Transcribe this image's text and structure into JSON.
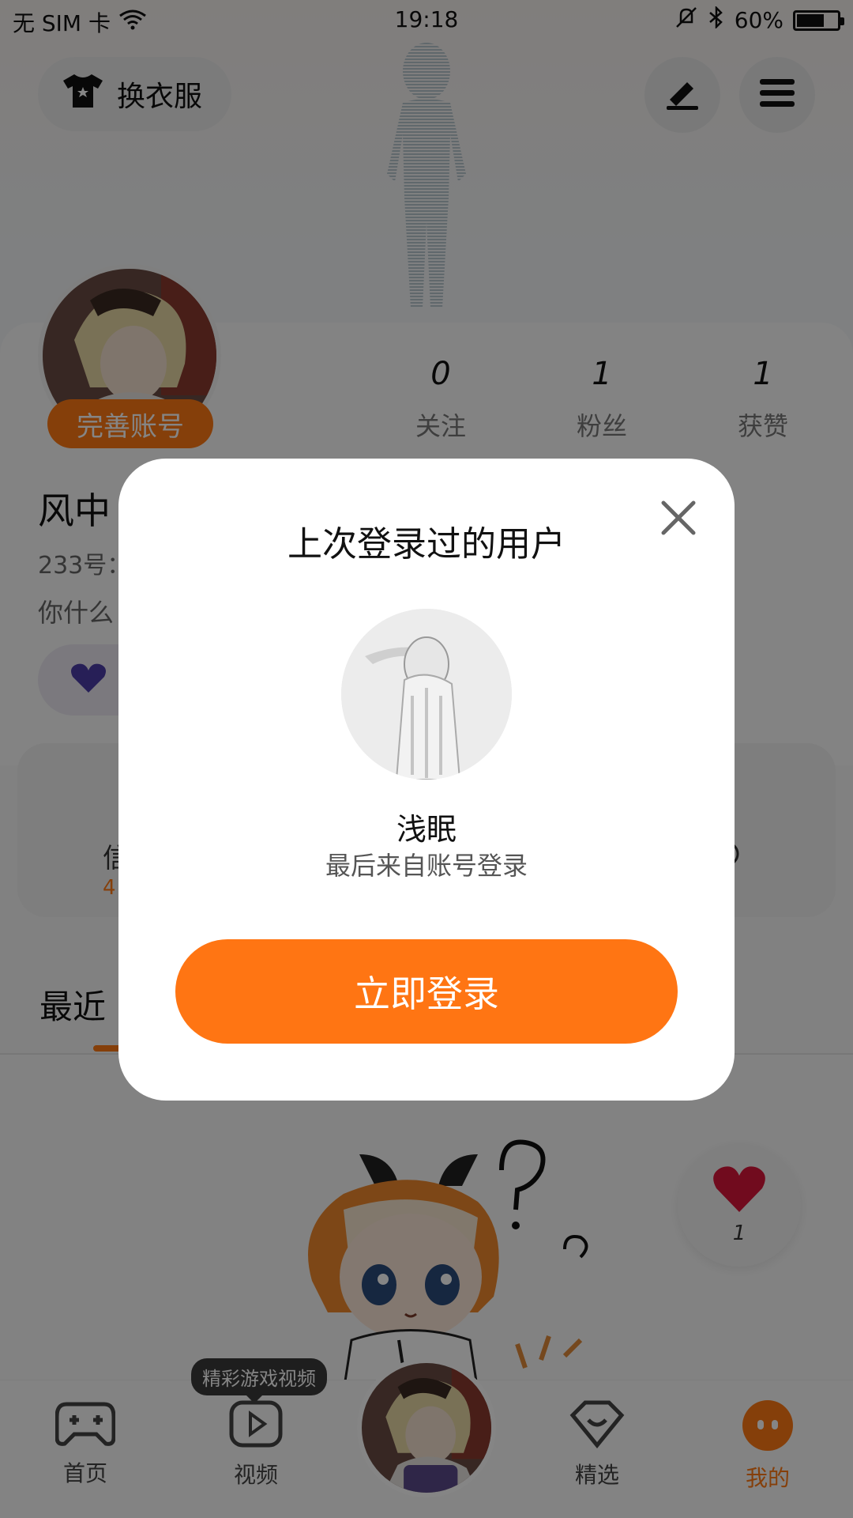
{
  "status_bar": {
    "carrier": "无 SIM 卡",
    "time": "19:18",
    "battery_percent": "60%"
  },
  "top_bar": {
    "outfit_label": "换衣服",
    "edit_icon": "pen-icon",
    "menu_icon": "menu-icon"
  },
  "profile": {
    "complete_account_label": "完善账号",
    "name": "风中",
    "uid": "233号：",
    "bio": "你什么",
    "stats": [
      {
        "value": "0",
        "label": "关注"
      },
      {
        "value": "1",
        "label": "粉丝"
      },
      {
        "value": "1",
        "label": "获赞"
      }
    ]
  },
  "info_card": {
    "text": "信",
    "sub": "4"
  },
  "section": {
    "title": "最近"
  },
  "like_bubble": {
    "count": "1"
  },
  "bottom_nav": {
    "tooltip": "精彩游戏视频",
    "items": [
      {
        "label": "首页",
        "icon": "gamepad-icon"
      },
      {
        "label": "视频",
        "icon": "play-icon"
      },
      {
        "label": "精选",
        "icon": "heart-box-icon"
      },
      {
        "label": "我的",
        "icon": "face-icon"
      }
    ],
    "active_color": "#ff7a14"
  },
  "modal": {
    "title": "上次登录过的用户",
    "username": "浅眠",
    "subtitle": "最后来自账号登录",
    "login_button": "立即登录"
  },
  "colors": {
    "accent": "#ff7513",
    "overlay": "rgba(0,0,0,0.48)"
  }
}
